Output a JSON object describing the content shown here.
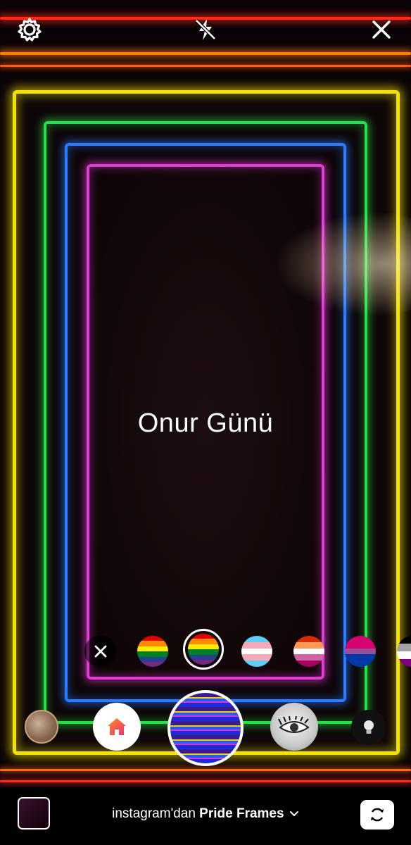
{
  "top_bar": {
    "settings_icon": "gear-icon",
    "flash_icon": "flash-off-icon",
    "close_icon": "close-icon"
  },
  "overlay": {
    "title": "Onur Günü"
  },
  "effects_tray": {
    "clear_icon": "close-icon",
    "flags": [
      {
        "name": "rainbow-flag-6",
        "selected": false
      },
      {
        "name": "progress-rainbow-flag",
        "selected": true
      },
      {
        "name": "transgender-flag",
        "selected": false
      },
      {
        "name": "lesbian-flag",
        "selected": false
      },
      {
        "name": "bisexual-flag",
        "selected": false
      },
      {
        "name": "asexual-flag",
        "selected": false
      }
    ]
  },
  "mode_carousel": {
    "items": [
      "portrait-effect",
      "home-effect",
      "pride-frames-effect",
      "eyelash-effect",
      "light-bulb-effect"
    ]
  },
  "bottom": {
    "prefix": "instagram'dan",
    "effect_name": "Pride Frames",
    "chevron_icon": "chevron-down-icon",
    "switch_camera_icon": "switch-camera-icon",
    "gallery_icon": "gallery-thumbnail"
  },
  "colors": {
    "yellow": "#f5e100",
    "green": "#26e04a",
    "blue": "#2a7dff",
    "magenta": "#e23bd8",
    "red": "#ff2a1a",
    "orange": "#ff7a12"
  }
}
